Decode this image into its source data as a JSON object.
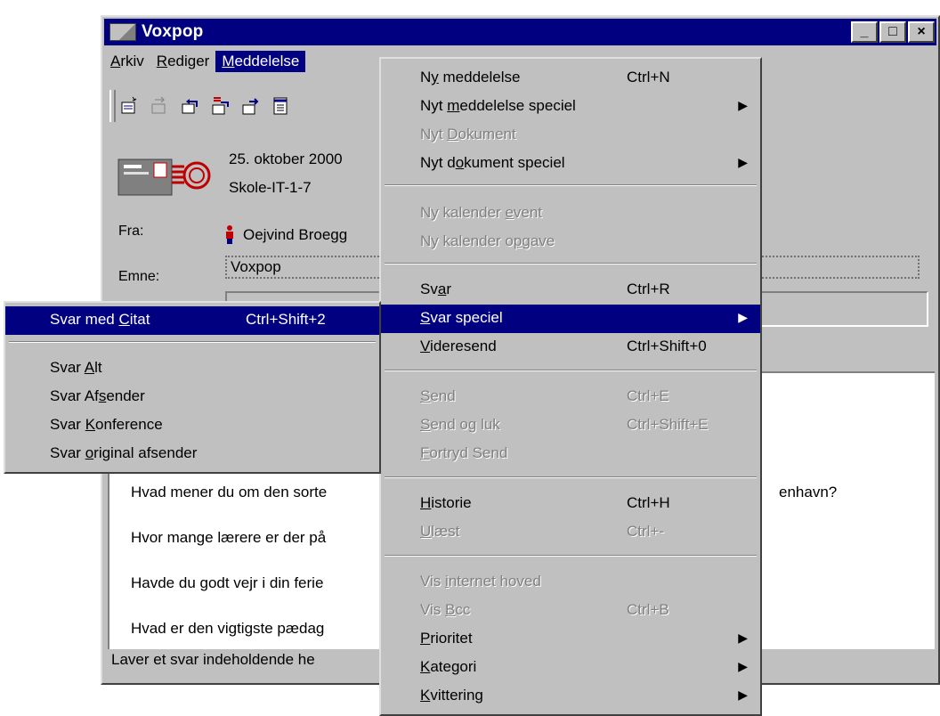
{
  "window": {
    "title": "Voxpop",
    "minimize": "_",
    "maximize": "□",
    "close": "×"
  },
  "menubar": {
    "items": [
      {
        "label": "Arkiv",
        "mnemonic": "A",
        "rest": "rkiv"
      },
      {
        "label": "Rediger",
        "mnemonic": "R",
        "rest": "ediger"
      },
      {
        "label": "Meddelelse",
        "mnemonic": "M",
        "rest": "eddelelse"
      }
    ]
  },
  "toolbar": {
    "icons": [
      "new-message-icon",
      "forward-icon",
      "reply-icon",
      "reply-all-icon",
      "send-icon",
      "document-icon"
    ]
  },
  "header": {
    "date": "25. oktober 2000",
    "conference": "Skole-IT-1-7",
    "from_label": "Fra:",
    "from_value": "Oejvind Broegg",
    "subject_label": "Emne:",
    "subject_value": "Voxpop"
  },
  "body": {
    "lines": [
      "Hvad mener du om den sorte",
      "enhavn?",
      "Hvor mange lærere er der på",
      "Havde du godt vejr i din ferie",
      "Hvad er den vigtigste pædag"
    ]
  },
  "statusbar": {
    "text": "Laver et svar indeholdende he"
  },
  "main_menu": {
    "items": [
      {
        "pre": "N",
        "u": "y",
        "post": " meddelelse",
        "shortcut": "Ctrl+N",
        "disabled": false
      },
      {
        "pre": "Nyt ",
        "u": "m",
        "post": "eddelelse speciel",
        "shortcut": "",
        "submenu": true,
        "disabled": false
      },
      {
        "pre": "Nyt ",
        "u": "D",
        "post": "okument",
        "shortcut": "",
        "disabled": true
      },
      {
        "pre": "Nyt d",
        "u": "o",
        "post": "kument speciel",
        "shortcut": "",
        "submenu": true,
        "disabled": false
      },
      {
        "pre": "Ny kalender ",
        "u": "e",
        "post": "vent",
        "shortcut": "",
        "disabled": true
      },
      {
        "pre": "Ny kalender o",
        "u": "p",
        "post": "gave",
        "shortcut": "",
        "disabled": true
      },
      {
        "pre": "Sv",
        "u": "a",
        "post": "r",
        "shortcut": "Ctrl+R",
        "disabled": false
      },
      {
        "pre": "",
        "u": "S",
        "post": "var speciel",
        "shortcut": "",
        "submenu": true,
        "disabled": false,
        "highlighted": true
      },
      {
        "pre": "",
        "u": "V",
        "post": "ideresend",
        "shortcut": "Ctrl+Shift+0",
        "disabled": false
      },
      {
        "pre": "",
        "u": "S",
        "post": "end",
        "shortcut": "Ctrl+E",
        "disabled": true
      },
      {
        "pre": "",
        "u": "S",
        "post": "end og luk",
        "shortcut": "Ctrl+Shift+E",
        "disabled": true
      },
      {
        "pre": "",
        "u": "F",
        "post": "ortryd Send",
        "shortcut": "",
        "disabled": true
      },
      {
        "pre": "",
        "u": "H",
        "post": "istorie",
        "shortcut": "Ctrl+H",
        "disabled": false
      },
      {
        "pre": "",
        "u": "U",
        "post": "læst",
        "shortcut": "Ctrl+-",
        "disabled": true
      },
      {
        "pre": "Vis ",
        "u": "i",
        "post": "nternet hoved",
        "shortcut": "",
        "disabled": true
      },
      {
        "pre": "Vis ",
        "u": "B",
        "post": "cc",
        "shortcut": "Ctrl+B",
        "disabled": true
      },
      {
        "pre": "",
        "u": "P",
        "post": "rioritet",
        "shortcut": "",
        "submenu": true,
        "disabled": false
      },
      {
        "pre": "",
        "u": "K",
        "post": "ategori",
        "shortcut": "",
        "submenu": true,
        "disabled": false
      },
      {
        "pre": "",
        "u": "K",
        "post": "vittering",
        "shortcut": "",
        "submenu": true,
        "disabled": false
      }
    ]
  },
  "sub_menu": {
    "items": [
      {
        "pre": "Svar med ",
        "u": "C",
        "post": "itat",
        "shortcut": "Ctrl+Shift+2",
        "highlighted": true
      },
      {
        "pre": "Svar ",
        "u": "A",
        "post": "lt",
        "shortcut": ""
      },
      {
        "pre": "Svar Af",
        "u": "s",
        "post": "ender",
        "shortcut": ""
      },
      {
        "pre": "Svar ",
        "u": "K",
        "post": "onference",
        "shortcut": ""
      },
      {
        "pre": "Svar ",
        "u": "o",
        "post": "riginal afsender",
        "shortcut": ""
      }
    ]
  },
  "arrow_glyph": "▶"
}
